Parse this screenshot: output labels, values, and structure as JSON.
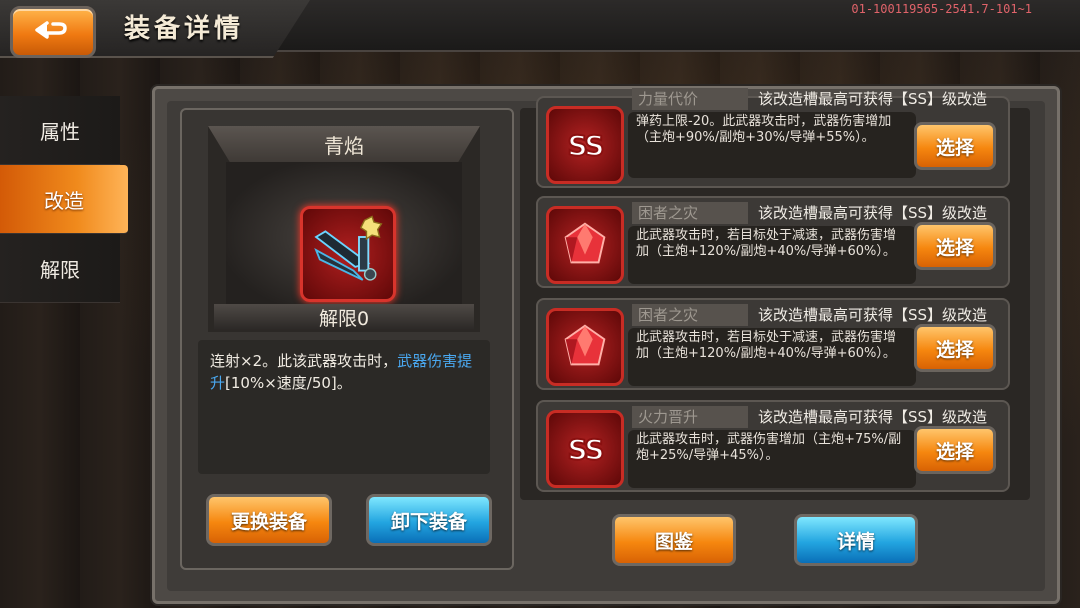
{
  "header": {
    "title": "装备详情",
    "version": "01-100119565-2541.7-101~1"
  },
  "sidebar": {
    "tabs": [
      {
        "label": "属性"
      },
      {
        "label": "改造"
      },
      {
        "label": "解限"
      }
    ],
    "active": "改造"
  },
  "item": {
    "name": "青焰",
    "level": "解限0",
    "desc_prefix": "连射×2。此该武器攻击时，",
    "desc_highlight": "武器伤害提升",
    "desc_suffix": "[10%×速度/50]。"
  },
  "left_buttons": {
    "change": "更换装备",
    "remove": "卸下装备"
  },
  "slots": [
    {
      "name": "力量代价",
      "limit": "该改造槽最高可获得【SS】级改造",
      "desc": "弹药上限-20。此武器攻击时，武器伤害增加（主炮+90%/副炮+30%/导弹+55%）。",
      "icon": "ss-badge-icon",
      "badge": "SS",
      "select": "选择"
    },
    {
      "name": "困者之灾",
      "limit": "该改造槽最高可获得【SS】级改造",
      "desc": "此武器攻击时，若目标处于减速，武器伤害增加（主炮+120%/副炮+40%/导弹+60%）。",
      "icon": "red-gem-icon",
      "badge": "",
      "select": "选择"
    },
    {
      "name": "困者之灾",
      "limit": "该改造槽最高可获得【SS】级改造",
      "desc": "此武器攻击时，若目标处于减速，武器伤害增加（主炮+120%/副炮+40%/导弹+60%）。",
      "icon": "red-gem-icon",
      "badge": "",
      "select": "选择"
    },
    {
      "name": "火力晋升",
      "limit": "该改造槽最高可获得【SS】级改造",
      "desc": "此武器攻击时，武器伤害增加（主炮+75%/副炮+25%/导弹+45%）。",
      "icon": "ss-badge-icon",
      "badge": "SS",
      "select": "选择"
    }
  ],
  "bottom_buttons": {
    "codex": "图鉴",
    "details": "详情"
  },
  "colors": {
    "accent_orange": "#f6870f",
    "accent_blue": "#23a5e0",
    "highlight_text": "#4aa8f0",
    "version_text": "#e0636a"
  }
}
